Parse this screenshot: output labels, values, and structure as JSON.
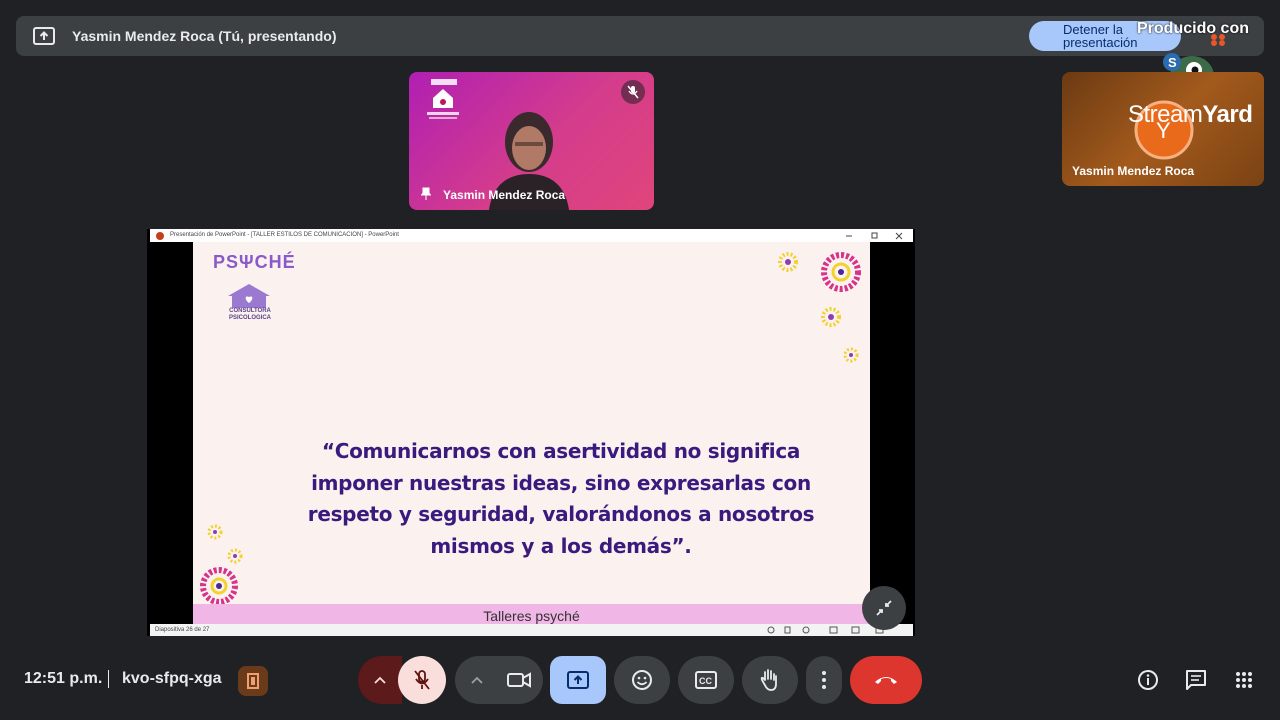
{
  "header": {
    "presenter_title": "Yasmin Mendez Roca (Tú, presentando)",
    "stop_button_label": "Detener la presentación",
    "produced_by": "Producido con"
  },
  "participants": {
    "self_name": "Yasmin Mendez Roca",
    "streamyard_name": "Yasmin Mendez Roca",
    "streamyard_brand_light": "Stream",
    "streamyard_brand_bold": "Yard"
  },
  "presentation": {
    "window_title": "Presentación de PowerPoint - [TALLER ESTILOS DE COMUNICACION] - PowerPoint",
    "logo_word": "PSΨCHÉ",
    "logo_sub": "CONSULTORA PSICOLOGICA",
    "quote": "“Comunicarnos con asertividad no significa imponer nuestras ideas, sino expresarlas con respeto y seguridad, valorándonos a nosotros mismos y a los demás”.",
    "footer": "Talleres psyché",
    "slide_status": "Diapositiva 26 de 27"
  },
  "bottom_bar": {
    "time": "12:51 p.m.",
    "meeting_code": "kvo-sfpq-xga"
  },
  "colors": {
    "background": "#202124",
    "present_accent": "#a8c7fa",
    "hangup_red": "#dc362e",
    "mic_off_bg": "#f9dedc",
    "quote_purple": "#3b1a7e"
  },
  "icons": {
    "present": "present-to-all-icon",
    "mic_off": "mic-off-icon",
    "camera": "videocam-icon",
    "emoji": "emoji-icon",
    "captions": "closed-caption-icon",
    "raise_hand": "raise-hand-icon",
    "more": "more-vert-icon",
    "hangup": "call-end-icon",
    "info": "info-icon",
    "chat": "chat-icon",
    "activities": "apps-grid-icon"
  }
}
